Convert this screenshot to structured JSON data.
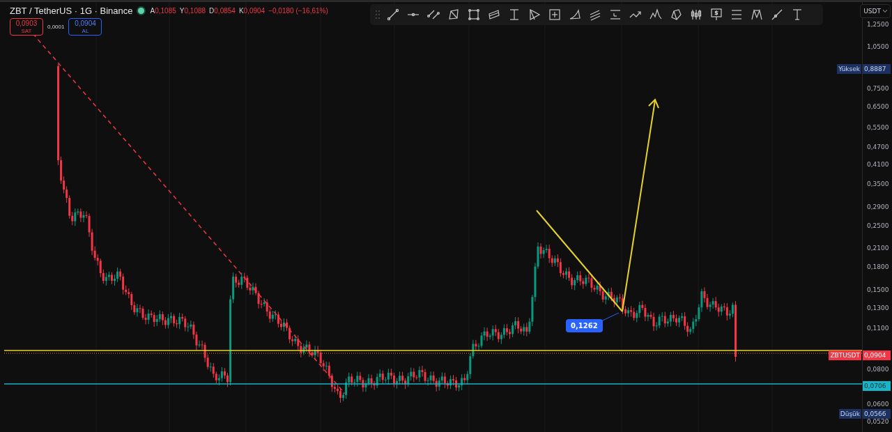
{
  "header": {
    "symbol": "ZBT / TetherUS · 1G · Binance",
    "ohlc": [
      {
        "letter": "A",
        "value": "0,1085"
      },
      {
        "letter": "Y",
        "value": "0,1088"
      },
      {
        "letter": "D",
        "value": "0,0854"
      },
      {
        "letter": "K",
        "value": "0,0904"
      }
    ],
    "change": "−0,0180 (−16,61%)"
  },
  "trade": {
    "sell": {
      "price": "0,0903",
      "label": "SAT"
    },
    "spread": "0,0001",
    "buy": {
      "price": "0,0904",
      "label": "AL"
    }
  },
  "price_axis": {
    "currency": "USDT",
    "ticks": [
      "1,2500",
      "1,0500",
      "0,7500",
      "0,6500",
      "0,5500",
      "0,4700",
      "0,4100",
      "0,3500",
      "0,2900",
      "0,2500",
      "0,2100",
      "0,1800",
      "0,1500",
      "0,1300",
      "0,1100",
      "0,0800",
      "0,0600",
      "0,0520"
    ],
    "badges": [
      {
        "kind": "high",
        "label": "Yüksek",
        "value": "0,8887"
      },
      {
        "kind": "last",
        "label": "ZBTUSDT",
        "value": "0,0904"
      },
      {
        "kind": "line",
        "value": "0,0706"
      },
      {
        "kind": "low",
        "label": "Düşük",
        "value": "0,0566"
      }
    ]
  },
  "chart": {
    "callout": "0,1262"
  }
}
